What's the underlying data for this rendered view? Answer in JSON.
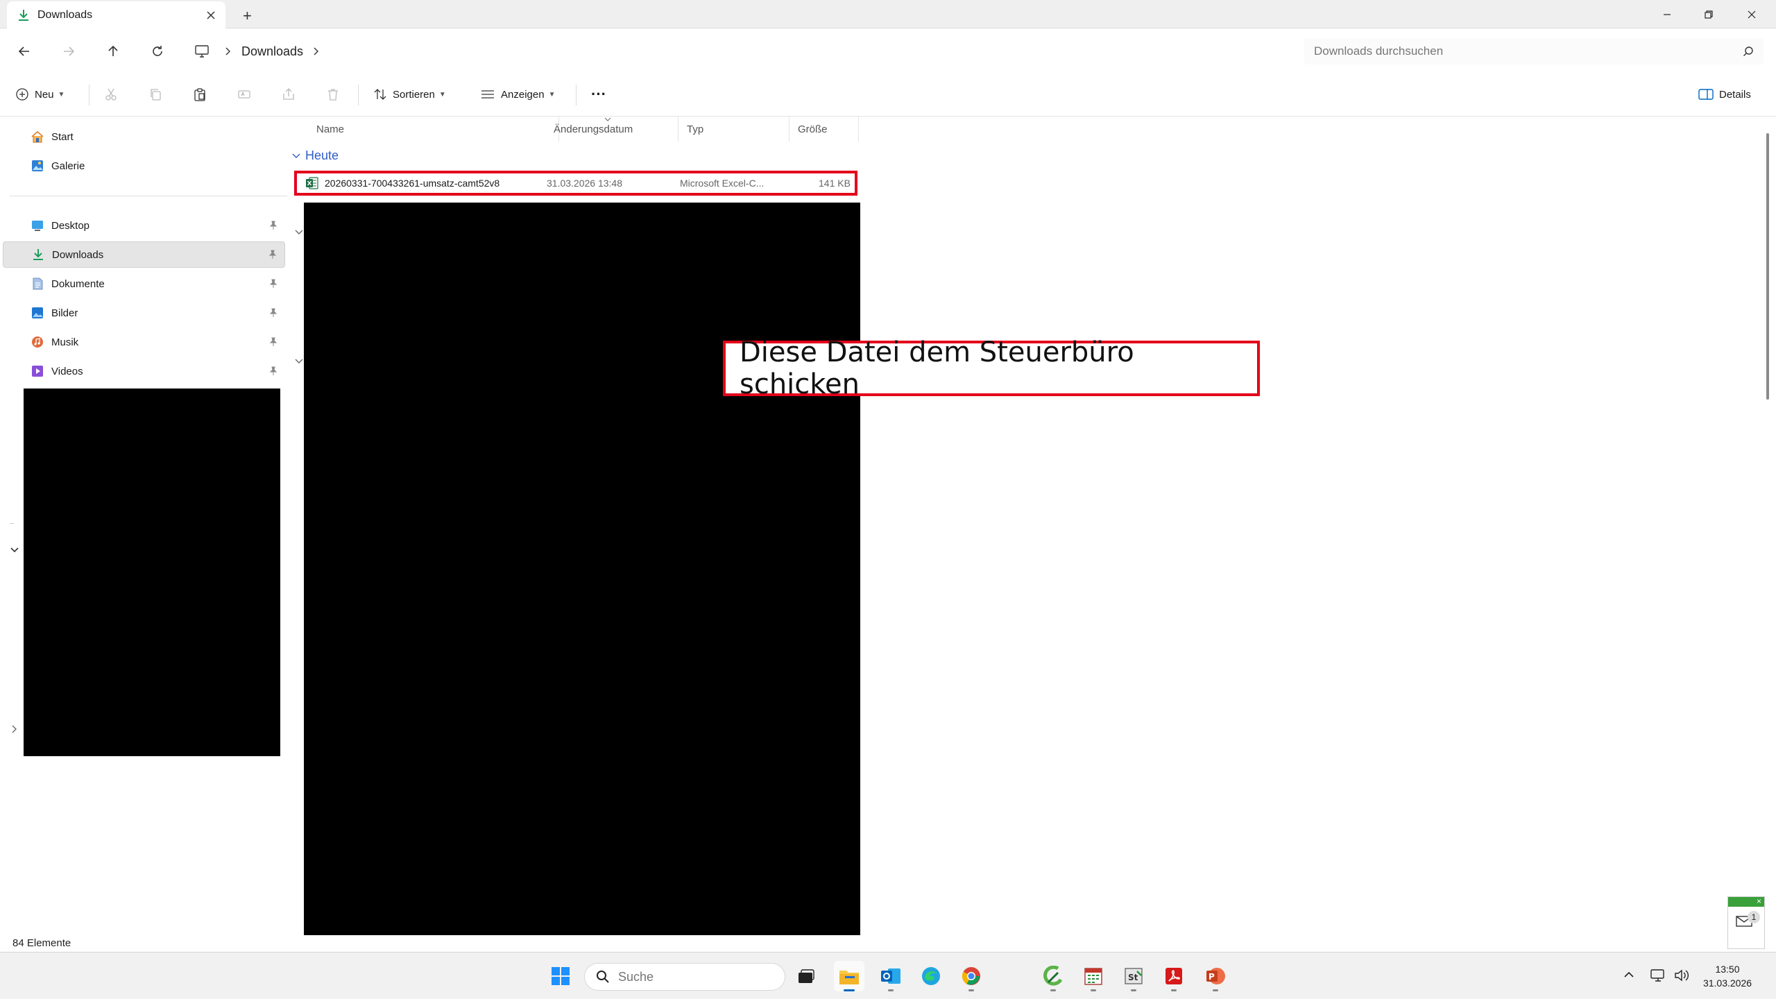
{
  "window": {
    "tab_title": "Downloads",
    "new_tab": "+"
  },
  "address": {
    "crumb": "Downloads",
    "search_placeholder": "Downloads durchsuchen"
  },
  "toolbar": {
    "new_label": "Neu",
    "sort_label": "Sortieren",
    "view_label": "Anzeigen",
    "more_label": "···",
    "details_label": "Details"
  },
  "sidebar": {
    "top_items": [
      {
        "label": "Start",
        "icon": "home-icon"
      },
      {
        "label": "Galerie",
        "icon": "gallery-icon"
      }
    ],
    "pinned_items": [
      {
        "label": "Desktop",
        "icon": "desktop-icon"
      },
      {
        "label": "Downloads",
        "icon": "download-icon",
        "selected": true
      },
      {
        "label": "Dokumente",
        "icon": "document-icon"
      },
      {
        "label": "Bilder",
        "icon": "pictures-icon"
      },
      {
        "label": "Musik",
        "icon": "music-icon"
      },
      {
        "label": "Videos",
        "icon": "video-icon"
      }
    ]
  },
  "columns": {
    "name": "Name",
    "date": "Änderungsdatum",
    "type": "Typ",
    "size": "Größe"
  },
  "files": {
    "group_label": "Heute",
    "rows": [
      {
        "name": "20260331-700433261-umsatz-camt52v8",
        "date": "31.03.2026 13:48",
        "type": "Microsoft Excel-C...",
        "size": "141 KB",
        "icon": "excel-icon"
      }
    ]
  },
  "annotation": {
    "text": "Diese Datei dem Steuerbüro schicken",
    "color": "#e3001b"
  },
  "status": {
    "count": "84 Elemente"
  },
  "taskbar": {
    "search_placeholder": "Suche",
    "time": "13:50",
    "date": "31.03.2026",
    "notification_count": "1"
  }
}
